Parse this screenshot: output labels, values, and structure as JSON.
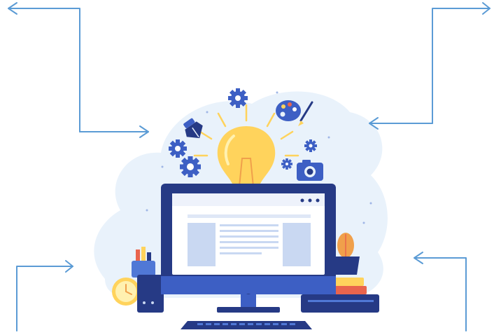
{
  "scene": {
    "subject": "idea-lightbulb-above-computer-monitor",
    "icons": [
      "lightbulb-icon",
      "gear-icon",
      "pen-nib-icon",
      "palette-icon",
      "brush-icon",
      "camera-icon",
      "pencil-cup-icon",
      "clock-icon",
      "cactus-icon",
      "books-icon",
      "keyboard-icon",
      "computer-monitor-icon"
    ],
    "arrow_count": 4,
    "colors": {
      "arrow": "#5b9bd5",
      "blob": "#e9f2fb",
      "navy": "#263a85",
      "blue": "#3d5fc4",
      "mid_blue": "#5078d6",
      "light_blue": "#c9d8f2",
      "bulb_yellow": "#ffd35c",
      "bulb_light": "#fff1b0",
      "orange": "#f0a04b",
      "red": "#e9644d"
    }
  }
}
